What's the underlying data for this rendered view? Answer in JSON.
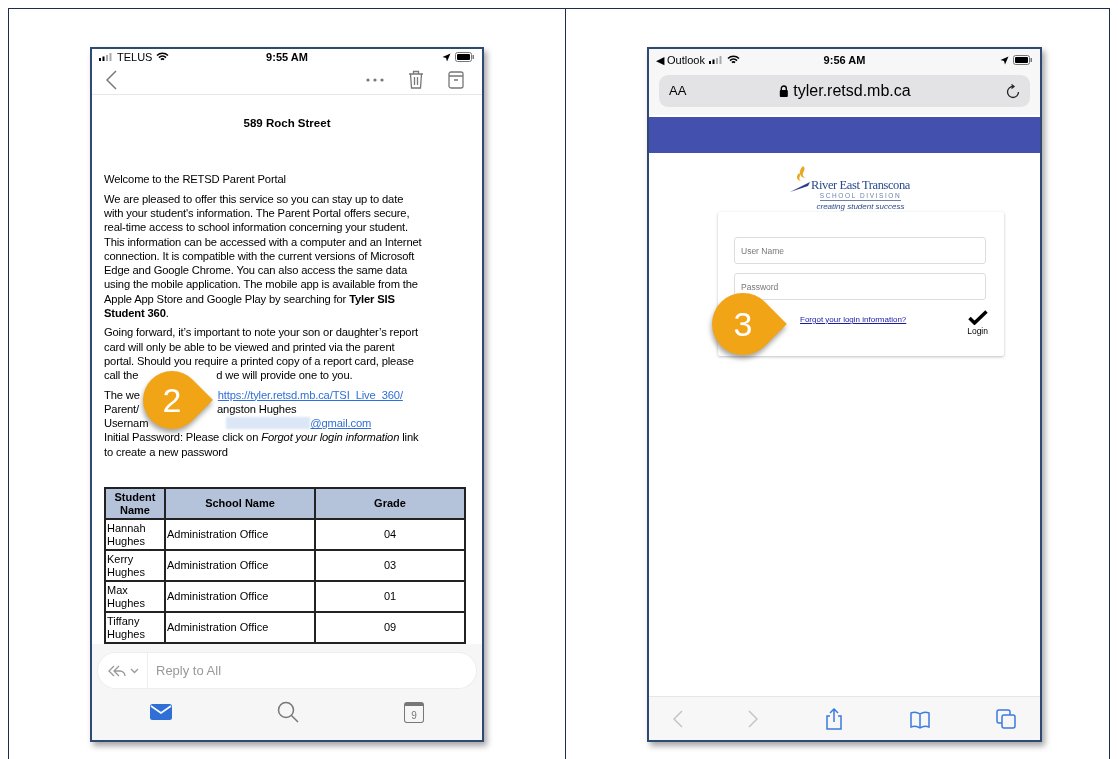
{
  "left_phone": {
    "status_bar": {
      "carrier": "TELUS",
      "time": "9:55 AM"
    },
    "email": {
      "subject": "589 Roch Street",
      "paragraphs": [
        [
          [
            {
              "kind": "text",
              "text": "Welcome to the RETSD Parent Portal"
            }
          ]
        ],
        [
          [
            {
              "kind": "text",
              "text": "We are pleased to offer this service so you can stay up to date"
            }
          ],
          [
            {
              "kind": "text",
              "text": "with your student's information. The Parent Portal offers secure,"
            }
          ],
          [
            {
              "kind": "text",
              "text": "real-time access to school information concerning your student."
            }
          ],
          [
            {
              "kind": "text",
              "text": "This information can be accessed with a computer and an Internet"
            }
          ],
          [
            {
              "kind": "text",
              "text": "connection. It is compatible with the current versions of Microsoft"
            }
          ],
          [
            {
              "kind": "text",
              "text": "Edge and Google Chrome. You can also access the same data"
            }
          ],
          [
            {
              "kind": "text",
              "text": "using the mobile application. The mobile app is available from the"
            }
          ],
          [
            {
              "kind": "text",
              "text": "Apple App Store and Google Play by searching for **Tyler SIS**"
            }
          ],
          [
            {
              "kind": "text",
              "text": "**Student 360**."
            }
          ]
        ],
        [
          [
            {
              "kind": "text",
              "text": "Going forward, it’s important to note your son or daughter’s report"
            }
          ],
          [
            {
              "kind": "text",
              "text": "card will only be able to be viewed and printed via the parent"
            }
          ],
          [
            {
              "kind": "text",
              "text": "portal. Should you require a printed copy of a report card, please"
            }
          ],
          [
            {
              "kind": "text",
              "text": "call the"
            },
            {
              "kind": "text",
              "text": "d we will provide one to you."
            }
          ]
        ],
        [
          [
            {
              "kind": "text",
              "text": "The we"
            },
            {
              "kind": "link",
              "text": "https://tyler.retsd.mb.ca/TSI_Live_360/"
            }
          ],
          [
            {
              "kind": "text",
              "text": "Parent/"
            },
            {
              "kind": "text",
              "text": "angston Hughes"
            }
          ],
          [
            {
              "kind": "text",
              "text": "Usernam"
            },
            {
              "kind": "redacted"
            },
            {
              "kind": "link",
              "text": "@gmail.com"
            }
          ],
          [
            {
              "kind": "text",
              "text": "Initial Password: Please click on *Forgot your login information* link"
            }
          ],
          [
            {
              "kind": "text",
              "text": "to create a new password"
            }
          ]
        ]
      ]
    },
    "table": {
      "columns": [
        "Student Name",
        "School Name",
        "Grade"
      ],
      "rows": [
        [
          "Hannah Hughes",
          "Administration Office",
          "04"
        ],
        [
          "Kerry Hughes",
          "Administration Office",
          "03"
        ],
        [
          "Max Hughes",
          "Administration Office",
          "01"
        ],
        [
          "Tiffany Hughes",
          "Administration Office",
          "09"
        ]
      ]
    },
    "reply_bar": {
      "placeholder": "Reply to All"
    },
    "tab_bar": [
      {
        "kind": "mail",
        "selected": true
      },
      {
        "kind": "search",
        "selected": false
      },
      {
        "kind": "calendar",
        "selected": false,
        "label": "9"
      }
    ],
    "callout": "2"
  },
  "right_phone": {
    "status_bar": {
      "back_app": "◀ Outlook",
      "time": "9:56 AM"
    },
    "address_bar": {
      "text_size": "AA",
      "url": "tyler.retsd.mb.ca"
    },
    "logo": {
      "name": "River East Transcona",
      "division": "SCHOOL DIVISION",
      "tagline": "creating student success"
    },
    "login": {
      "username_placeholder": "User Name",
      "password_placeholder": "Password",
      "forgot_link": "Forgot your login information?",
      "login_button": "Login"
    },
    "callout": "3",
    "toolbar": [
      {
        "kind": "back",
        "disabled": true
      },
      {
        "kind": "forward",
        "disabled": true
      },
      {
        "kind": "share",
        "disabled": false
      },
      {
        "kind": "bookmarks",
        "disabled": false
      },
      {
        "kind": "tabs",
        "disabled": false
      }
    ]
  }
}
